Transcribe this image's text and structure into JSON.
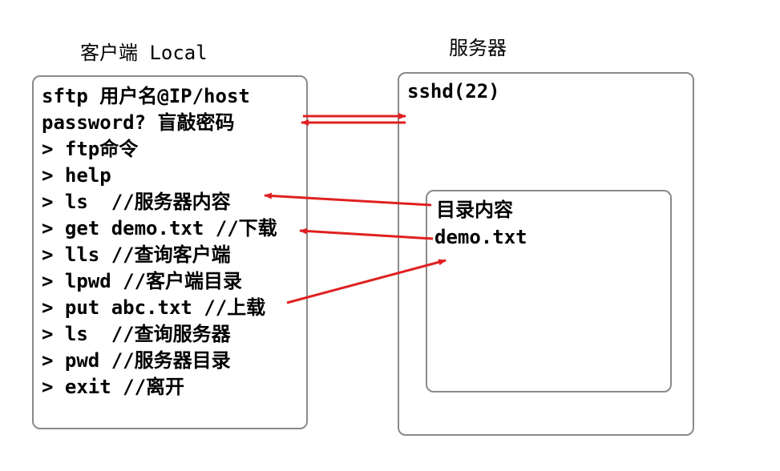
{
  "client": {
    "title": "客户端 Local",
    "lines": [
      "sftp 用户名@IP/host",
      "password? 盲敲密码",
      "> ftp命令",
      "> help",
      "> ls  //服务器内容",
      "> get demo.txt //下载",
      "> lls //查询客户端",
      "> lpwd //客户端目录",
      "> put abc.txt //上载",
      "> ls  //查询服务器",
      "> pwd //服务器目录",
      "> exit //离开"
    ]
  },
  "server": {
    "title": "服务器",
    "daemon": "sshd(22)",
    "dir_title": "目录内容",
    "dir_file": "demo.txt"
  },
  "colors": {
    "arrow": "#e02020",
    "border": "#8a8a8a"
  }
}
